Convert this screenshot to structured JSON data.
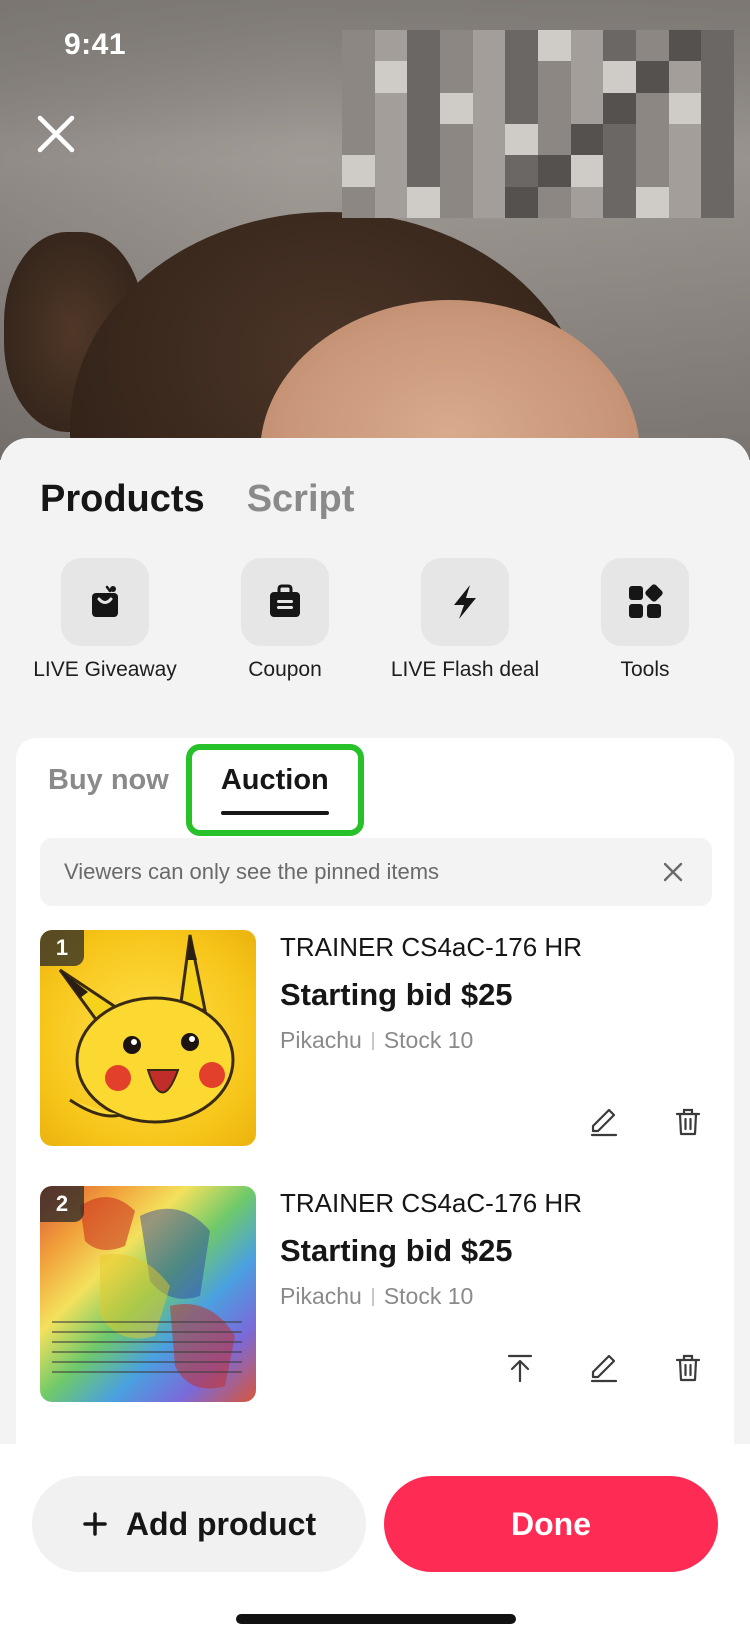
{
  "status_bar": {
    "time": "9:41"
  },
  "header": {
    "close_icon": "close-icon"
  },
  "sheet": {
    "tabs": [
      {
        "label": "Products",
        "active": true
      },
      {
        "label": "Script",
        "active": false
      }
    ],
    "tools": [
      {
        "label": "LIVE Giveaway",
        "icon": "giveaway-bag-icon"
      },
      {
        "label": "Coupon",
        "icon": "coupon-icon"
      },
      {
        "label": "LIVE Flash deal",
        "icon": "lightning-icon"
      },
      {
        "label": "Tools",
        "icon": "grid-tools-icon"
      }
    ],
    "sub_tabs": [
      {
        "label": "Buy now",
        "active": false
      },
      {
        "label": "Auction",
        "active": true
      }
    ],
    "notice": {
      "text": "Viewers can only see the pinned items"
    },
    "products": [
      {
        "index": "1",
        "name": "TRAINER CS4aC-176 HR",
        "bid": "Starting bid $25",
        "variant": "Pikachu",
        "stock": "Stock 10",
        "image": "pikachu-card"
      },
      {
        "index": "2",
        "name": "TRAINER CS4aC-176 HR",
        "bid": "Starting bid $25",
        "variant": "Pikachu",
        "stock": "Stock 10",
        "image": "rainbow-trainer-card"
      }
    ]
  },
  "bottom_bar": {
    "add_label": "Add product",
    "done_label": "Done"
  },
  "colors": {
    "accent": "#fe2c55",
    "highlight": "#27c12a",
    "sheet_bg": "#f3f3f3"
  }
}
